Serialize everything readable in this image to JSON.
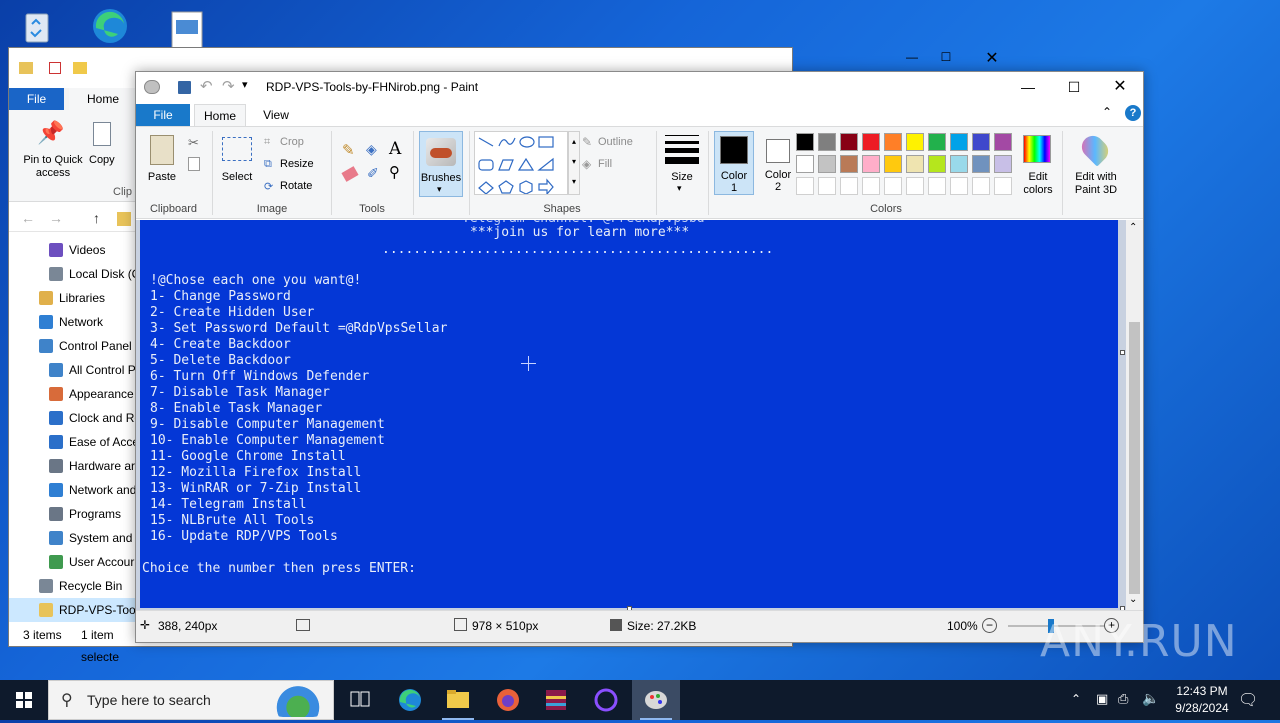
{
  "explorer": {
    "tabs": [
      "File",
      "Home"
    ],
    "ribbon": {
      "pin_label": "Pin to Quick access",
      "copy_label": "Copy",
      "clipboard_partial": "Clip"
    },
    "nav_items": [
      {
        "label": "Videos",
        "color": "#6d4fbf"
      },
      {
        "label": "Local Disk (C",
        "color": "#7a8796"
      },
      {
        "label": "Libraries",
        "color": "#e0b04b"
      },
      {
        "label": "Network",
        "color": "#2f7fd3"
      },
      {
        "label": "Control Panel",
        "color": "#3f83c9"
      },
      {
        "label": "All Control P",
        "color": "#3f83c9"
      },
      {
        "label": "Appearance",
        "color": "#d86b3a"
      },
      {
        "label": "Clock and Re",
        "color": "#2b6fc9"
      },
      {
        "label": "Ease of Acce",
        "color": "#2b6fc9"
      },
      {
        "label": "Hardware ar",
        "color": "#6a7686"
      },
      {
        "label": "Network and",
        "color": "#2f7fd3"
      },
      {
        "label": "Programs",
        "color": "#6a7686"
      },
      {
        "label": "System and",
        "color": "#3f83c9"
      },
      {
        "label": "User Accour",
        "color": "#3f9a4f"
      },
      {
        "label": "Recycle Bin",
        "color": "#7a8796"
      },
      {
        "label": "RDP-VPS-Tool",
        "color": "#e8c35a"
      }
    ],
    "status": {
      "items": "3 items",
      "selected": "1 item selecte"
    }
  },
  "paint": {
    "title": "RDP-VPS-Tools-by-FHNirob.png - Paint",
    "tabs": [
      "File",
      "Home",
      "View"
    ],
    "clipboard": {
      "paste": "Paste",
      "group": "Clipboard"
    },
    "image": {
      "select": "Select",
      "crop": "Crop",
      "resize": "Resize",
      "rotate": "Rotate",
      "group": "Image"
    },
    "tools": {
      "group": "Tools"
    },
    "brushes": {
      "label": "Brushes"
    },
    "shapes": {
      "outline": "Outline",
      "fill": "Fill",
      "group": "Shapes"
    },
    "size": {
      "label": "Size"
    },
    "color1": {
      "label": "Color",
      "num": "1"
    },
    "color2": {
      "label": "Color",
      "num": "2"
    },
    "colors": {
      "group": "Colors",
      "edit": "Edit colors",
      "paint3d": "Edit with Paint 3D"
    },
    "palette_row1": [
      "#000000",
      "#7f7f7f",
      "#880015",
      "#ed1c24",
      "#ff7f27",
      "#fff200",
      "#22b14c",
      "#00a2e8",
      "#3f48cc",
      "#a349a4"
    ],
    "palette_row2": [
      "#ffffff",
      "#c3c3c3",
      "#b97a57",
      "#ffaec9",
      "#ffc90e",
      "#efe4b0",
      "#b5e61d",
      "#99d9ea",
      "#7092be",
      "#c8bfe7"
    ],
    "canvas_lines": {
      "header1": "***join us for learn more***",
      "dots": "..................................................",
      "prompt_title": "!@Chose each one you want@!",
      "options": [
        "1- Change Password",
        "2- Create Hidden User",
        "3- Set Password Default =@RdpVpsSellar",
        "4- Create Backdoor",
        "5- Delete Backdoor",
        "6- Turn Off Windows Defender",
        "7- Disable Task Manager",
        "8- Enable Task Manager",
        "9- Disable Computer Management",
        "10- Enable Computer Management",
        "11- Google Chrome Install",
        "12- Mozilla Firefox Install",
        "13- WinRAR or 7-Zip Install",
        "14- Telegram Install",
        "15- NLBrute All Tools",
        "16- Update RDP/VPS Tools"
      ],
      "choice": "Choice the number then press ENTER:"
    },
    "status": {
      "cursor": "388, 240px",
      "dimensions": "978 × 510px",
      "size": "Size: 27.2KB",
      "zoom": "100%"
    }
  },
  "taskbar": {
    "search_placeholder": "Type here to search",
    "time": "12:43 PM",
    "date": "9/28/2024"
  },
  "watermark": "ANY.RUN"
}
